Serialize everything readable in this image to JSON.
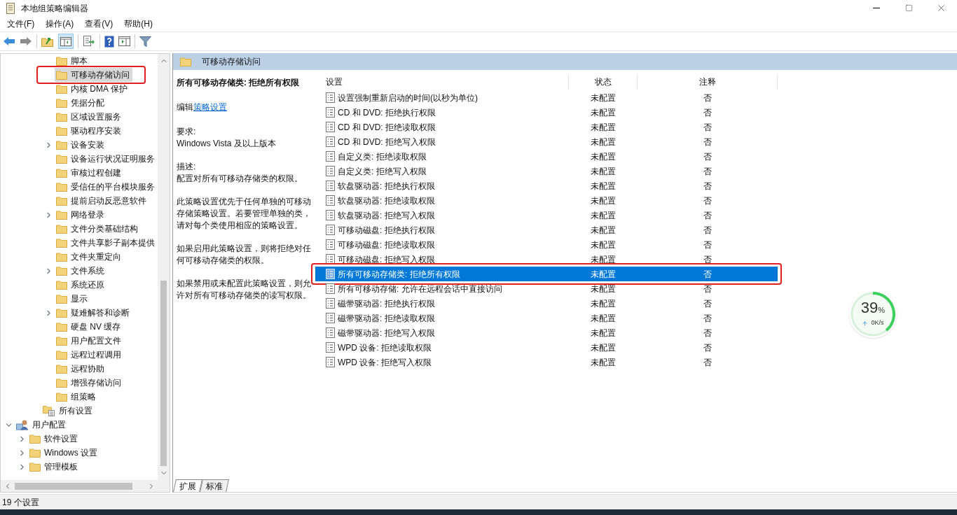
{
  "window": {
    "title": "本地组策略编辑器"
  },
  "menu": [
    "文件(F)",
    "操作(A)",
    "查看(V)",
    "帮助(H)"
  ],
  "tree": [
    {
      "children": [
        {
          "children": [
            {
              "children": [
                {
                  "label": "脚本",
                  "expandable": false,
                  "selected": false,
                  "annotated": false
                },
                {
                  "label": "可移动存储访问",
                  "expandable": false,
                  "selected": true,
                  "annotated": true
                },
                {
                  "label": "内核 DMA 保护",
                  "expandable": false,
                  "selected": false,
                  "annotated": false
                },
                {
                  "label": "凭据分配",
                  "expandable": false,
                  "selected": false,
                  "annotated": false
                },
                {
                  "label": "区域设置服务",
                  "expandable": false,
                  "selected": false,
                  "annotated": false
                },
                {
                  "label": "驱动程序安装",
                  "expandable": false,
                  "selected": false,
                  "annotated": false
                },
                {
                  "label": "设备安装",
                  "expandable": true,
                  "selected": false,
                  "annotated": false
                },
                {
                  "label": "设备运行状况证明服务",
                  "expandable": false,
                  "selected": false,
                  "annotated": false
                },
                {
                  "label": "审核过程创建",
                  "expandable": false,
                  "selected": false,
                  "annotated": false
                },
                {
                  "label": "受信任的平台模块服务",
                  "expandable": false,
                  "selected": false,
                  "annotated": false
                },
                {
                  "label": "提前启动反恶意软件",
                  "expandable": false,
                  "selected": false,
                  "annotated": false
                },
                {
                  "label": "网络登录",
                  "expandable": true,
                  "selected": false,
                  "annotated": false
                },
                {
                  "label": "文件分类基础结构",
                  "expandable": false,
                  "selected": false,
                  "annotated": false
                },
                {
                  "label": "文件共享影子副本提供",
                  "expandable": false,
                  "selected": false,
                  "annotated": false
                },
                {
                  "label": "文件夹重定向",
                  "expandable": false,
                  "selected": false,
                  "annotated": false
                },
                {
                  "label": "文件系统",
                  "expandable": true,
                  "selected": false,
                  "annotated": false
                },
                {
                  "label": "系统还原",
                  "expandable": false,
                  "selected": false,
                  "annotated": false
                },
                {
                  "label": "显示",
                  "expandable": false,
                  "selected": false,
                  "annotated": false
                },
                {
                  "label": "疑难解答和诊断",
                  "expandable": true,
                  "selected": false,
                  "annotated": false
                },
                {
                  "label": "硬盘 NV 缓存",
                  "expandable": false,
                  "selected": false,
                  "annotated": false
                },
                {
                  "label": "用户配置文件",
                  "expandable": false,
                  "selected": false,
                  "annotated": false
                },
                {
                  "label": "远程过程调用",
                  "expandable": false,
                  "selected": false,
                  "annotated": false
                },
                {
                  "label": "远程协助",
                  "expandable": false,
                  "selected": false,
                  "annotated": false
                },
                {
                  "label": "增强存储访问",
                  "expandable": false,
                  "selected": false,
                  "annotated": false
                },
                {
                  "label": "组策略",
                  "expandable": false,
                  "selected": false,
                  "annotated": false
                }
              ]
            },
            {
              "label": "所有设置",
              "kind": "settings",
              "expandable": false,
              "selected": false,
              "annotated": false
            }
          ]
        }
      ]
    },
    {
      "label": "用户配置",
      "kind": "user",
      "expandable": true,
      "expanded": true,
      "selected": false,
      "annotated": false,
      "children": [
        {
          "label": "软件设置",
          "expandable": true,
          "selected": false,
          "annotated": false
        },
        {
          "label": "Windows 设置",
          "expandable": true,
          "selected": false,
          "annotated": false
        },
        {
          "label": "管理模板",
          "expandable": true,
          "selected": false,
          "annotated": false
        }
      ]
    }
  ],
  "pane_header": "可移动存储访问",
  "description": {
    "title": "所有可移动存储类: 拒绝所有权限",
    "edit_prefix": "编辑",
    "edit_link": "策略设置",
    "paragraphs": [
      [
        "要求:",
        "Windows Vista 及以上版本"
      ],
      [
        "描述:",
        "配置对所有可移动存储类的权限。"
      ],
      [
        "此策略设置优先于任何单独的可移动存储策略设置。若要管理单独的类，请对每个类使用相应的策略设置。"
      ],
      [
        "如果启用此策略设置，则将拒绝对任何可移动存储类的权限。"
      ],
      [
        "如果禁用或未配置此策略设置，则允许对所有可移动存储类的读写权限。"
      ]
    ]
  },
  "table": {
    "columns": [
      "设置",
      "状态",
      "注释"
    ],
    "rows": [
      {
        "setting": "设置强制重新启动的时间(以秒为单位)",
        "state": "未配置",
        "comment": "否",
        "selected": false,
        "annotated": false
      },
      {
        "setting": "CD 和 DVD: 拒绝执行权限",
        "state": "未配置",
        "comment": "否",
        "selected": false,
        "annotated": false
      },
      {
        "setting": "CD 和 DVD: 拒绝读取权限",
        "state": "未配置",
        "comment": "否",
        "selected": false,
        "annotated": false
      },
      {
        "setting": "CD 和 DVD: 拒绝写入权限",
        "state": "未配置",
        "comment": "否",
        "selected": false,
        "annotated": false
      },
      {
        "setting": "自定义类: 拒绝读取权限",
        "state": "未配置",
        "comment": "否",
        "selected": false,
        "annotated": false
      },
      {
        "setting": "自定义类: 拒绝写入权限",
        "state": "未配置",
        "comment": "否",
        "selected": false,
        "annotated": false
      },
      {
        "setting": "软盘驱动器: 拒绝执行权限",
        "state": "未配置",
        "comment": "否",
        "selected": false,
        "annotated": false
      },
      {
        "setting": "软盘驱动器: 拒绝读取权限",
        "state": "未配置",
        "comment": "否",
        "selected": false,
        "annotated": false
      },
      {
        "setting": "软盘驱动器: 拒绝写入权限",
        "state": "未配置",
        "comment": "否",
        "selected": false,
        "annotated": false
      },
      {
        "setting": "可移动磁盘: 拒绝执行权限",
        "state": "未配置",
        "comment": "否",
        "selected": false,
        "annotated": false
      },
      {
        "setting": "可移动磁盘: 拒绝读取权限",
        "state": "未配置",
        "comment": "否",
        "selected": false,
        "annotated": false
      },
      {
        "setting": "可移动磁盘: 拒绝写入权限",
        "state": "未配置",
        "comment": "否",
        "selected": false,
        "annotated": false
      },
      {
        "setting": "所有可移动存储类: 拒绝所有权限",
        "state": "未配置",
        "comment": "否",
        "selected": true,
        "annotated": true
      },
      {
        "setting": "所有可移动存储: 允许在远程会话中直接访问",
        "state": "未配置",
        "comment": "否",
        "selected": false,
        "annotated": false
      },
      {
        "setting": "磁带驱动器: 拒绝执行权限",
        "state": "未配置",
        "comment": "否",
        "selected": false,
        "annotated": false
      },
      {
        "setting": "磁带驱动器: 拒绝读取权限",
        "state": "未配置",
        "comment": "否",
        "selected": false,
        "annotated": false
      },
      {
        "setting": "磁带驱动器: 拒绝写入权限",
        "state": "未配置",
        "comment": "否",
        "selected": false,
        "annotated": false
      },
      {
        "setting": "WPD 设备: 拒绝读取权限",
        "state": "未配置",
        "comment": "否",
        "selected": false,
        "annotated": false
      },
      {
        "setting": "WPD 设备: 拒绝写入权限",
        "state": "未配置",
        "comment": "否",
        "selected": false,
        "annotated": false
      }
    ]
  },
  "view_tabs": [
    {
      "label": "扩展",
      "selected": true
    },
    {
      "label": "标准",
      "selected": false
    }
  ],
  "status_bar": "19 个设置",
  "speed_widget": {
    "percent": "39",
    "unit": "%",
    "level": 0.39,
    "speed": "0K/s"
  }
}
